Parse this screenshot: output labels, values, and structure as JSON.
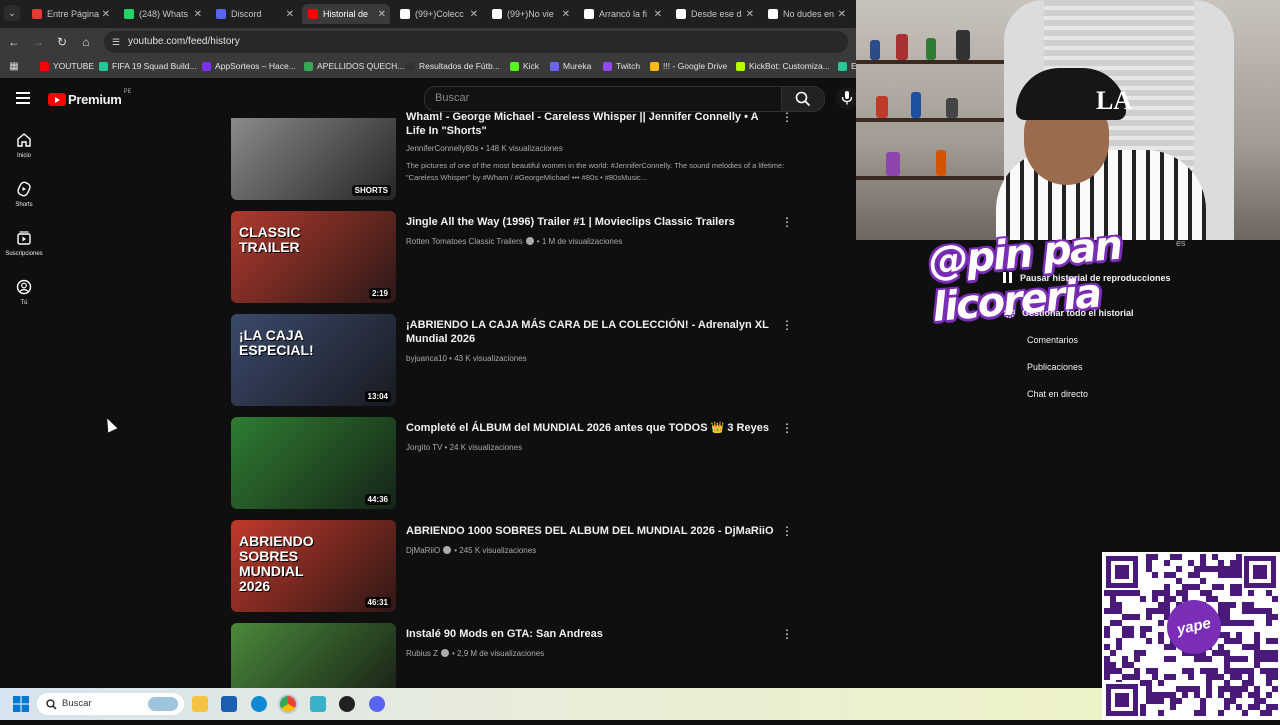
{
  "browser": {
    "tabs": [
      {
        "label": "Entre Página",
        "color": "#e53935"
      },
      {
        "label": "(248) Whats",
        "color": "#25d366"
      },
      {
        "label": "Discord",
        "color": "#5865f2"
      },
      {
        "label": "Historial de",
        "color": "#ff0000"
      },
      {
        "label": "(99+)Colecc",
        "color": "#ffffff"
      },
      {
        "label": "(99+)No vie",
        "color": "#ffffff"
      },
      {
        "label": "Arrancó la fi",
        "color": "#ffffff"
      },
      {
        "label": "Desde ese d",
        "color": "#ffffff"
      },
      {
        "label": "No dudes en",
        "color": "#ffffff"
      }
    ],
    "url": "youtube.com/feed/history",
    "bookmarks": [
      {
        "label": "YOUTUBE",
        "color": "#ff0000"
      },
      {
        "label": "FIFA 19 Squad Build...",
        "color": "#20c997"
      },
      {
        "label": "AppSorteos – Hace...",
        "color": "#7b2ff7"
      },
      {
        "label": "APELLIDOS QUECH...",
        "color": "#34a853"
      },
      {
        "label": "Resultados de Fútb...",
        "color": "#333333"
      },
      {
        "label": "Kick",
        "color": "#53fc18"
      },
      {
        "label": "Mureka",
        "color": "#6c63ff"
      },
      {
        "label": "Twitch",
        "color": "#9146ff"
      },
      {
        "label": "!!! - Google Drive",
        "color": "#fbbc04"
      },
      {
        "label": "KickBot: Customiza...",
        "color": "#b6ff00"
      },
      {
        "label": "E",
        "color": "#20c997"
      }
    ]
  },
  "youtube": {
    "logo_text": "Premium",
    "region": "PE",
    "search_placeholder": "Buscar",
    "sidebar": [
      {
        "label": "Inicio",
        "icon": "home-icon"
      },
      {
        "label": "Shorts",
        "icon": "shorts-icon"
      },
      {
        "label": "Suscripciones",
        "icon": "subscriptions-icon"
      },
      {
        "label": "Tú",
        "icon": "you-icon"
      }
    ],
    "videos": [
      {
        "title": "Wham! - George Michael - Careless Whisper || Jennifer Connelly • A Life In \"Shorts\"",
        "channel": "JenniferConnelly80s",
        "views": "148 K visualizaciones",
        "desc": "The pictures of one of the most beautiful women in the world: #JenniferConnelly. The sound melodies of a lifetime: \"Careless Whisper\" by #Wham / #GeorgeMichael ••• #80s • #80sMusic...",
        "badge": "SHORTS",
        "verified": false,
        "thumb": "#8a8a8a"
      },
      {
        "title": "Jingle All the Way (1996) Trailer #1 | Movieclips Classic Trailers",
        "channel": "Rotten Tomatoes Classic Trailers",
        "views": "1 M de visualizaciones",
        "duration": "2:19",
        "verified": true,
        "thumb": "#b03a2e",
        "thumb_text": "CLASSIC TRAILER"
      },
      {
        "title": "¡ABRIENDO LA CAJA MÁS CARA DE LA COLECCIÓN! - Adrenalyn XL Mundial 2026",
        "channel": "byjuanca10",
        "views": "43 K visualizaciones",
        "duration": "13:04",
        "verified": false,
        "thumb": "#3b4a6b",
        "thumb_text": "¡LA CAJA ESPECIAL!"
      },
      {
        "title": "Completé el ÁLBUM del MUNDIAL 2026 antes que TODOS 👑 3 Reyes",
        "channel": "Jorgito TV",
        "views": "24 K visualizaciones",
        "duration": "44:36",
        "verified": false,
        "thumb": "#2e7d32"
      },
      {
        "title": "ABRIENDO 1000 SOBRES DEL ALBUM DEL MUNDIAL 2026 - DjMaRiiO",
        "channel": "DjMaRiiO",
        "views": "245 K visualizaciones",
        "duration": "46:31",
        "verified": true,
        "thumb": "#c0392b",
        "thumb_text": "ABRIENDO SOBRES MUNDIAL 2026"
      },
      {
        "title": "Instalé 90 Mods en GTA: San Andreas",
        "channel": "Rubius Z",
        "views": "2,9 M de visualizaciones",
        "verified": true,
        "thumb": "#4a8a3a"
      }
    ],
    "panel": {
      "pause": "Pausar historial de reproducciones",
      "manage": "Gestionar todo el historial",
      "links": [
        "Comentarios",
        "Publicaciones",
        "Chat en directo"
      ],
      "partial": "es"
    }
  },
  "overlay": {
    "brand": "@pin pan licoreria",
    "yape": "yape"
  },
  "taskbar": {
    "search": "Buscar"
  }
}
